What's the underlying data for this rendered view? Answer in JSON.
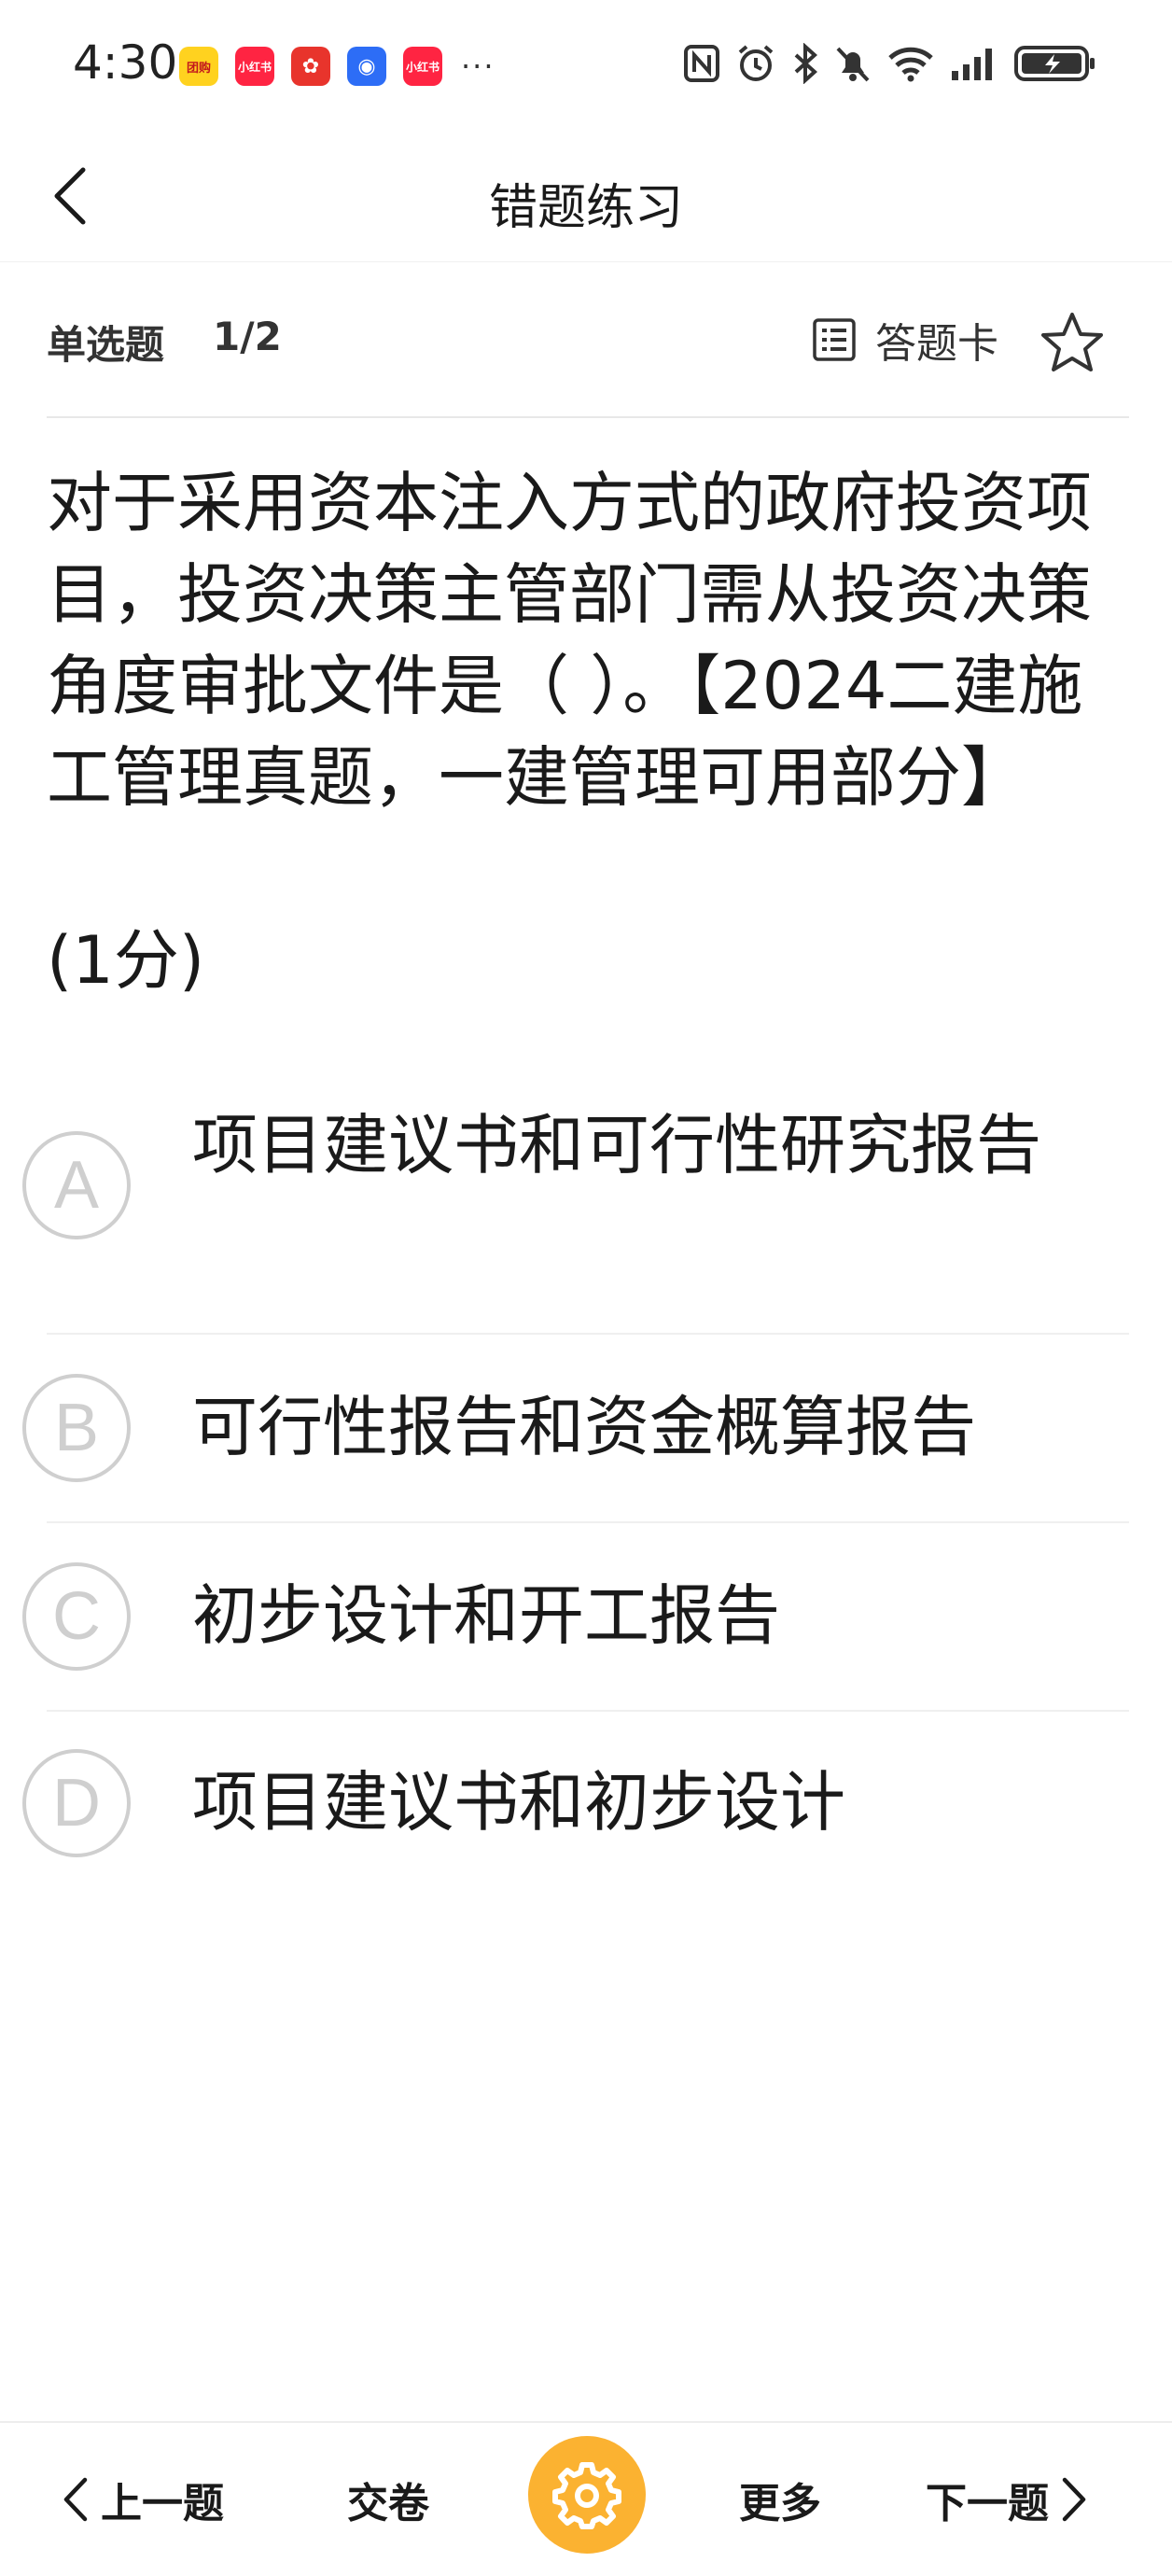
{
  "status_bar": {
    "time": "4:30",
    "apps": [
      {
        "name": "meituan-app-icon",
        "label": "团购"
      },
      {
        "name": "xiaohongshu-app-icon",
        "label": "小红书"
      },
      {
        "name": "huawei-app-icon",
        "label": "✿"
      },
      {
        "name": "blue-app-icon",
        "label": "◉"
      },
      {
        "name": "xiaohongshu-app-icon-2",
        "label": "小红书"
      }
    ],
    "more": "···"
  },
  "nav": {
    "title": "错题练习"
  },
  "question_header": {
    "type": "单选题",
    "index": "1/2",
    "answer_card_label": "答题卡"
  },
  "question": {
    "text": "对于采用资本注入方式的政府投资项目，投资决策主管部门需从投资决策角度审批文件是（ ）。【2024二建施工管理真题，一建管理可用部分】",
    "score": "(1分)"
  },
  "options": [
    {
      "letter": "A",
      "text": "项目建议书和可行性研究报告"
    },
    {
      "letter": "B",
      "text": "可行性报告和资金概算报告"
    },
    {
      "letter": "C",
      "text": "初步设计和开工报告"
    },
    {
      "letter": "D",
      "text": "项目建议书和初步设计"
    }
  ],
  "bottom_bar": {
    "prev_label": "上一题",
    "submit_label": "交卷",
    "more_label": "更多",
    "next_label": "下一题"
  },
  "colors": {
    "accent": "#fbb231",
    "option_circle": "#cfcfcf"
  }
}
